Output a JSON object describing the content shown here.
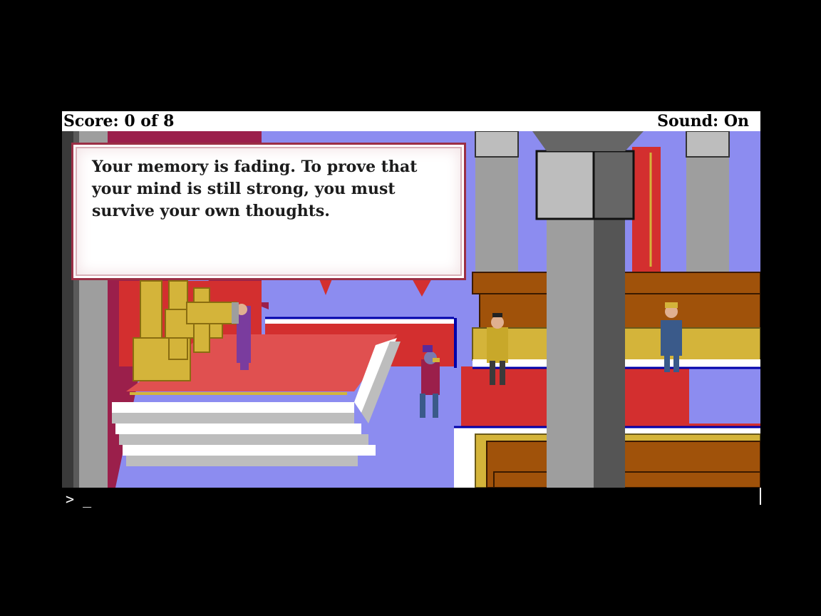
{
  "status_bar": {
    "score": "Score: 0 of 8",
    "sound": "Sound: On"
  },
  "message": {
    "text": "Your memory is fading. To prove that your mind is still strong, you must survive your own thoughts."
  },
  "command_line": {
    "prompt": ">",
    "cursor": "_"
  },
  "colors": {
    "carpet": "#d32f2f",
    "gold": "#d4b43a",
    "pillar": "#9e9e9e",
    "wall": "#8c8cf0",
    "banner": "#9b1f4b"
  }
}
